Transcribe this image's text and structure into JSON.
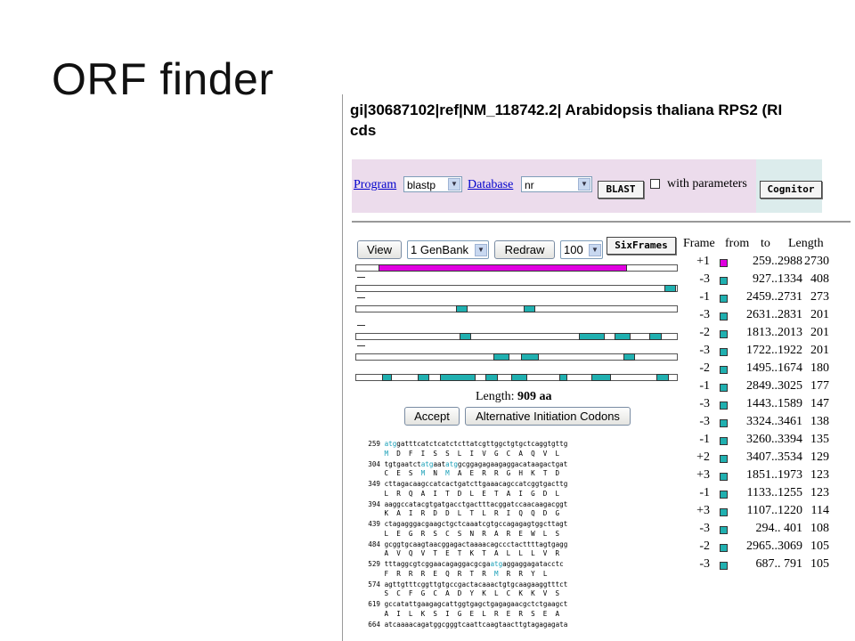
{
  "slide": {
    "title": "ORF finder"
  },
  "header": {
    "line1": "gi|30687102|ref|NM_118742.2| Arabidopsis thaliana RPS2 (RI",
    "line2": "cds"
  },
  "blast": {
    "program_label": "Program",
    "program_value": "blastp",
    "database_label": "Database",
    "database_value": "nr",
    "blast_button": "BLAST",
    "params_label": "with parameters",
    "cognitor_button": "Cognitor"
  },
  "toolbar": {
    "view_button": "View",
    "format_value": "1 GenBank",
    "redraw_button": "Redraw",
    "minlen_value": "100",
    "sixframes_button": "SixFrames"
  },
  "table": {
    "headers": {
      "frame": "Frame",
      "from": "from",
      "to": "to",
      "length": "Length"
    },
    "rows": [
      {
        "frame": "+1",
        "range": "259..2988",
        "length": "2730",
        "color": "#e000e0"
      },
      {
        "frame": "-3",
        "range": "927..1334",
        "length": "408",
        "color": "#20b0b0"
      },
      {
        "frame": "-1",
        "range": "2459..2731",
        "length": "273",
        "color": "#20b0b0"
      },
      {
        "frame": "-3",
        "range": "2631..2831",
        "length": "201",
        "color": "#20b0b0"
      },
      {
        "frame": "-2",
        "range": "1813..2013",
        "length": "201",
        "color": "#20b0b0"
      },
      {
        "frame": "-3",
        "range": "1722..1922",
        "length": "201",
        "color": "#20b0b0"
      },
      {
        "frame": "-2",
        "range": "1495..1674",
        "length": "180",
        "color": "#20b0b0"
      },
      {
        "frame": "-1",
        "range": "2849..3025",
        "length": "177",
        "color": "#20b0b0"
      },
      {
        "frame": "-3",
        "range": "1443..1589",
        "length": "147",
        "color": "#20b0b0"
      },
      {
        "frame": "-3",
        "range": "3324..3461",
        "length": "138",
        "color": "#20b0b0"
      },
      {
        "frame": "-1",
        "range": "3260..3394",
        "length": "135",
        "color": "#20b0b0"
      },
      {
        "frame": "+2",
        "range": "3407..3534",
        "length": "129",
        "color": "#20b0b0"
      },
      {
        "frame": "+3",
        "range": "1851..1973",
        "length": "123",
        "color": "#20b0b0"
      },
      {
        "frame": "-1",
        "range": "1133..1255",
        "length": "123",
        "color": "#20b0b0"
      },
      {
        "frame": "+3",
        "range": "1107..1220",
        "length": "114",
        "color": "#20b0b0"
      },
      {
        "frame": "-3",
        "range": "294.. 401",
        "length": "108",
        "color": "#20b0b0"
      },
      {
        "frame": "-2",
        "range": "2965..3069",
        "length": "105",
        "color": "#20b0b0"
      },
      {
        "frame": "-3",
        "range": "687.. 791",
        "length": "105",
        "color": "#20b0b0"
      }
    ]
  },
  "orf_map": {
    "length_label": "Length:",
    "length_value": "909 aa",
    "accept_button": "Accept",
    "alt_button": "Alternative Initiation Codons",
    "frames": [
      {
        "dash": false,
        "orfs": [
          {
            "start": 0.07,
            "end": 0.84,
            "color": "#e000e0"
          }
        ]
      },
      {
        "dash": true,
        "orfs": [
          {
            "start": 0.955,
            "end": 0.99,
            "color": "#20b0b0"
          }
        ]
      },
      {
        "dash": true,
        "orfs": [
          {
            "start": 0.31,
            "end": 0.345,
            "color": "#20b0b0"
          },
          {
            "start": 0.52,
            "end": 0.555,
            "color": "#20b0b0"
          }
        ]
      },
      {
        "dash": true,
        "orfs": [
          {
            "start": 0.32,
            "end": 0.355,
            "color": "#20b0b0"
          },
          {
            "start": 0.69,
            "end": 0.77,
            "color": "#20b0b0"
          },
          {
            "start": 0.8,
            "end": 0.85,
            "color": "#20b0b0"
          },
          {
            "start": 0.91,
            "end": 0.95,
            "color": "#20b0b0"
          }
        ]
      },
      {
        "dash": true,
        "orfs": [
          {
            "start": 0.425,
            "end": 0.475,
            "color": "#20b0b0"
          },
          {
            "start": 0.51,
            "end": 0.565,
            "color": "#20b0b0"
          },
          {
            "start": 0.83,
            "end": 0.865,
            "color": "#20b0b0"
          }
        ]
      },
      {
        "dash": false,
        "orfs": [
          {
            "start": 0.08,
            "end": 0.11,
            "color": "#20b0b0"
          },
          {
            "start": 0.19,
            "end": 0.225,
            "color": "#20b0b0"
          },
          {
            "start": 0.26,
            "end": 0.37,
            "color": "#20b0b0"
          },
          {
            "start": 0.4,
            "end": 0.44,
            "color": "#20b0b0"
          },
          {
            "start": 0.48,
            "end": 0.53,
            "color": "#20b0b0"
          },
          {
            "start": 0.63,
            "end": 0.655,
            "color": "#20b0b0"
          },
          {
            "start": 0.73,
            "end": 0.79,
            "color": "#20b0b0"
          },
          {
            "start": 0.93,
            "end": 0.97,
            "color": "#20b0b0"
          }
        ]
      }
    ]
  },
  "sequence": [
    {
      "pos": "259",
      "nt": [
        {
          "t": "atg",
          "s": true
        },
        {
          "t": "gatttcatctcatctcttatcgttggctgtgctcaggtgttg",
          "s": false
        }
      ],
      "aa": [
        {
          "t": "M",
          "s": true
        },
        {
          "t": "  D  F  I  S  S  L  I  V  G  C  A  Q  V  L",
          "s": false
        }
      ]
    },
    {
      "pos": "304",
      "nt": [
        {
          "t": "tgtgaatct",
          "s": false
        },
        {
          "t": "atg",
          "s": true
        },
        {
          "t": "aat",
          "s": false
        },
        {
          "t": "atg",
          "s": true
        },
        {
          "t": "gcggagagaagaggacataagactgat",
          "s": false
        }
      ],
      "aa": [
        {
          "t": "C  E  S  ",
          "s": false
        },
        {
          "t": "M",
          "s": true
        },
        {
          "t": "  N  ",
          "s": false
        },
        {
          "t": "M",
          "s": true
        },
        {
          "t": "  A  E  R  R  G  H  K  T  D",
          "s": false
        }
      ]
    },
    {
      "pos": "349",
      "nt": [
        {
          "t": "cttagacaagccatcactgatcttgaaacagccatcggtgacttg",
          "s": false
        }
      ],
      "aa": [
        {
          "t": "L  R  Q  A  I  T  D  L  E  T  A  I  G  D  L",
          "s": false
        }
      ]
    },
    {
      "pos": "394",
      "nt": [
        {
          "t": "aaggccatacgtgatgacctgactttacggatccaacaagacggt",
          "s": false
        }
      ],
      "aa": [
        {
          "t": "K  A  I  R  D  D  L  T  L  R  I  Q  Q  D  G",
          "s": false
        }
      ]
    },
    {
      "pos": "439",
      "nt": [
        {
          "t": "ctagagggacgaagctgctcaaatcgtgccagagagtggcttagt",
          "s": false
        }
      ],
      "aa": [
        {
          "t": "L  E  G  R  S  C  S  N  R  A  R  E  W  L  S",
          "s": false
        }
      ]
    },
    {
      "pos": "484",
      "nt": [
        {
          "t": "gcggtgcaagtaacggagactaaaacagccctacttttagtgagg",
          "s": false
        }
      ],
      "aa": [
        {
          "t": "A  V  Q  V  T  E  T  K  T  A  L  L  L  V  R",
          "s": false
        }
      ]
    },
    {
      "pos": "529",
      "nt": [
        {
          "t": "tttaggcgtcggaacagaggacgcga",
          "s": false
        },
        {
          "t": "atg",
          "s": true
        },
        {
          "t": "aggaggagatacctc",
          "s": false
        }
      ],
      "aa": [
        {
          "t": "F  R  R  R  E  Q  R  T  R  ",
          "s": false
        },
        {
          "t": "M",
          "s": true
        },
        {
          "t": "  R  R  Y  L",
          "s": false
        }
      ]
    },
    {
      "pos": "574",
      "nt": [
        {
          "t": "agttgtttcggttgtgccgactacaaactgtgcaagaaggtttct",
          "s": false
        }
      ],
      "aa": [
        {
          "t": "S  C  F  G  C  A  D  Y  K  L  C  K  K  V  S",
          "s": false
        }
      ]
    },
    {
      "pos": "619",
      "nt": [
        {
          "t": "gccatattgaagagcattggtgagctgagagaacgctctgaagct",
          "s": false
        }
      ],
      "aa": [
        {
          "t": "A  I  L  K  S  I  G  E  L  R  E  R  S  E  A",
          "s": false
        }
      ]
    },
    {
      "pos": "664",
      "nt": [
        {
          "t": "atcaaaacagatggcgggtcaattcaagtaacttgtagagagata",
          "s": false
        }
      ],
      "aa": []
    }
  ]
}
